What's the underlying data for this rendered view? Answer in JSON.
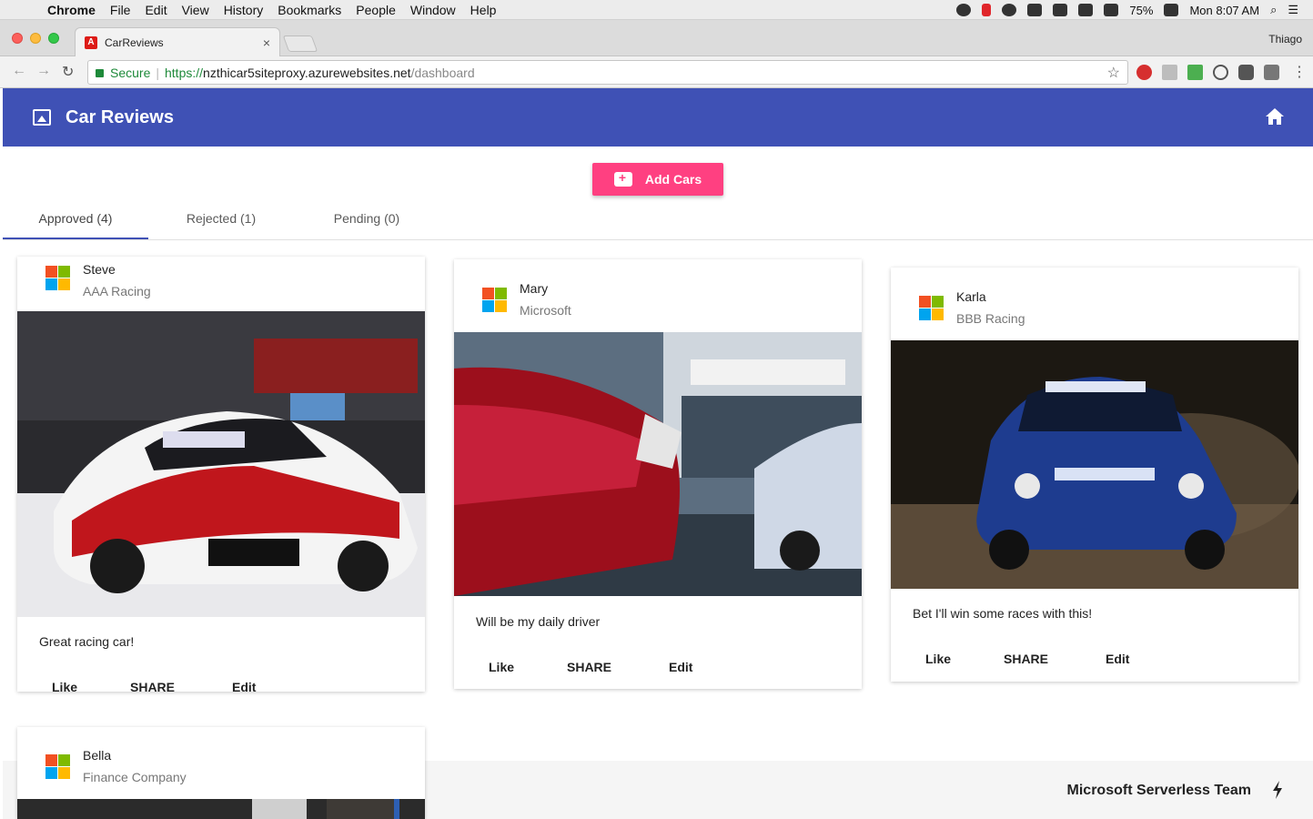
{
  "menubar": {
    "items": [
      "Chrome",
      "File",
      "Edit",
      "View",
      "History",
      "Bookmarks",
      "People",
      "Window",
      "Help"
    ],
    "battery": "75%",
    "clock": "Mon 8:07 AM"
  },
  "browser": {
    "tab_title": "CarReviews",
    "tab_favicon": "A",
    "profile_name": "Thiago",
    "secure_label": "Secure",
    "url_protocol": "https://",
    "url_host": "nzthicar5siteproxy.azurewebsites.net",
    "url_path": "/dashboard"
  },
  "app": {
    "title": "Car Reviews",
    "add_button_label": "Add Cars",
    "header_color": "#3f51b5",
    "accent_color": "#ff4081",
    "tabs": [
      {
        "label": "Approved (4)",
        "active": true
      },
      {
        "label": "Rejected (1)",
        "active": false
      },
      {
        "label": "Pending (0)",
        "active": false
      }
    ],
    "footer_text": "Microsoft Serverless Team"
  },
  "cards": [
    {
      "name": "Steve",
      "company": "AAA Racing",
      "description": "Great racing car!",
      "actions": [
        "Like",
        "SHARE",
        "Edit"
      ]
    },
    {
      "name": "Mary",
      "company": "Microsoft",
      "description": "Will be my daily driver",
      "actions": [
        "Like",
        "SHARE",
        "Edit"
      ]
    },
    {
      "name": "Karla",
      "company": "BBB Racing",
      "description": "Bet I'll win some races with this!",
      "actions": [
        "Like",
        "SHARE",
        "Edit"
      ]
    },
    {
      "name": "Bella",
      "company": "Finance Company"
    }
  ]
}
